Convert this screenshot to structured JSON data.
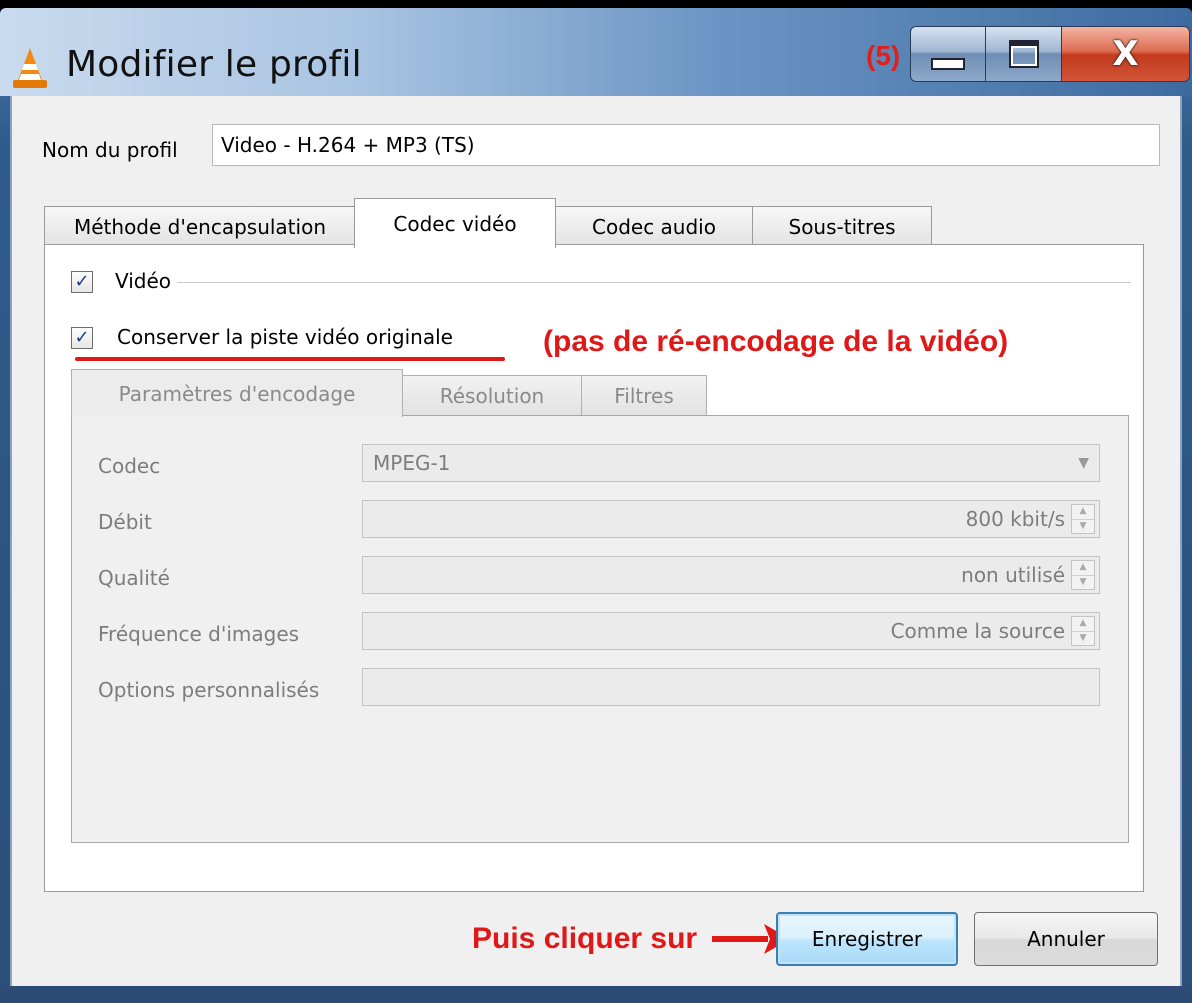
{
  "window": {
    "title": "Modifier le profil",
    "annotation_step": "(5)",
    "close_glyph": "X"
  },
  "profile": {
    "name_label": "Nom du profil",
    "name_value": "Video - H.264 + MP3 (TS)"
  },
  "tabs": [
    {
      "label": "Méthode d'encapsulation",
      "active": false
    },
    {
      "label": "Codec vidéo",
      "active": true
    },
    {
      "label": "Codec audio",
      "active": false
    },
    {
      "label": "Sous-titres",
      "active": false
    }
  ],
  "video": {
    "video_checkbox_label": "Vidéo",
    "video_checked": true,
    "keep_original_label": "Conserver la piste vidéo originale",
    "keep_original_checked": true,
    "annotation_no_reencode": "(pas de ré-encodage de la vidéo)",
    "check_glyph": "✓"
  },
  "subtabs": [
    {
      "label": "Paramètres d'encodage",
      "active": true
    },
    {
      "label": "Résolution",
      "active": false
    },
    {
      "label": "Filtres",
      "active": false
    }
  ],
  "encoding": {
    "codec_label": "Codec",
    "codec_value": "MPEG-1",
    "bitrate_label": "Débit",
    "bitrate_value": "800 kbit/s",
    "quality_label": "Qualité",
    "quality_value": "non utilisé",
    "framerate_label": "Fréquence d'images",
    "framerate_value": "Comme la source",
    "custom_options_label": "Options personnalisés",
    "custom_options_value": ""
  },
  "footer": {
    "annotation_click": "Puis cliquer sur",
    "save_label": "Enregistrer",
    "cancel_label": "Annuler"
  },
  "colors": {
    "annotation_red": "#e01818",
    "title_bar": "#6b95c4",
    "close_button": "#c33a1c"
  },
  "icons": {
    "app": "vlc-cone-icon",
    "minimize": "minimize-icon",
    "maximize": "maximize-icon",
    "close": "close-icon",
    "combo": "chevron-down-icon",
    "spin": "spin-arrows-icon",
    "arrow": "arrow-right-icon"
  }
}
